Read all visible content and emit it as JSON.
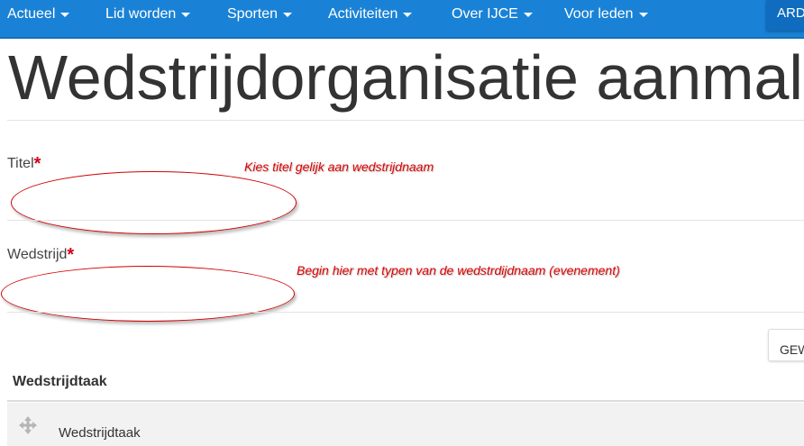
{
  "nav": {
    "items": [
      {
        "label": "Actueel"
      },
      {
        "label": "Lid worden"
      },
      {
        "label": "Sporten"
      },
      {
        "label": "Activiteiten"
      },
      {
        "label": "Over IJCE"
      },
      {
        "label": "Voor leden"
      }
    ],
    "user_label": "ARD"
  },
  "page": {
    "title": "Wedstrijdorganisatie aanmal"
  },
  "form": {
    "titel": {
      "label": "Titel",
      "required_mark": "*",
      "annotation": "Kies titel gelijk aan wedstrijdnaam"
    },
    "wedstrijd": {
      "label": "Wedstrijd",
      "required_mark": "*",
      "annotation": "Begin hier met typen van de wedstrdijdnaam (evenement)"
    }
  },
  "button": {
    "label": "GEW"
  },
  "table": {
    "header": "Wedstrijdtaak",
    "rows": [
      {
        "label": "Wedstrijdtaak"
      }
    ]
  },
  "colors": {
    "nav_bg": "#1a82d6",
    "annotation": "#e00000",
    "required": "#d0021b"
  },
  "icons": {
    "nav_caret": "caret-down-icon",
    "row_drag": "move-icon"
  }
}
